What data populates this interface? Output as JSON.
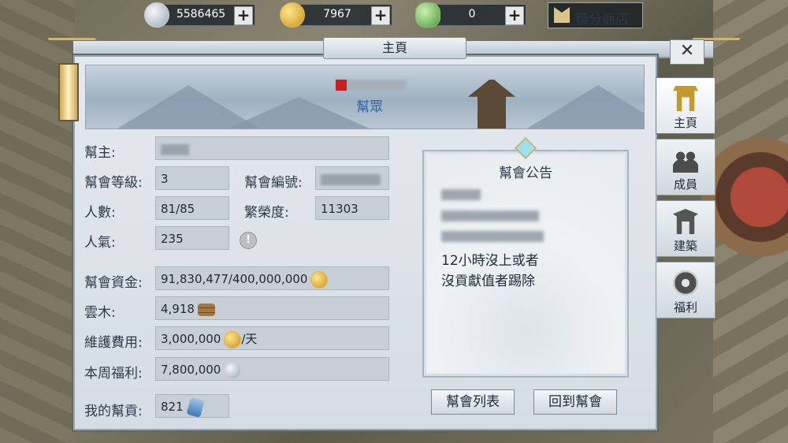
{
  "currencies": [
    {
      "name": "silver",
      "value": "5586465",
      "plus": "+"
    },
    {
      "name": "gold",
      "value": "7967",
      "plus": "+"
    },
    {
      "name": "jade",
      "value": "0",
      "plus": "+"
    }
  ],
  "shop_label": "積分商店",
  "window": {
    "title": "主頁",
    "close": "✕"
  },
  "banner": {
    "guild_type": "幫眾"
  },
  "info": {
    "leader_label": "幫主:",
    "level_label": "幫會等級:",
    "level": "3",
    "guild_id_label": "幫會編號:",
    "members_label": "人數:",
    "members": "81/85",
    "prosperity_label": "繁榮度:",
    "prosperity": "11303",
    "popularity_label": "人氣:",
    "popularity": "235",
    "funds_label": "幫會資金:",
    "funds": "91,830,477/400,000,000",
    "wood_label": "雲木:",
    "wood": "4,918",
    "maintenance_label": "維護費用:",
    "maintenance": "3,000,000",
    "maintenance_unit": "/天",
    "weekly_label": "本周福利:",
    "weekly": "7,800,000",
    "contrib_label": "我的幫貢:",
    "contrib": "821"
  },
  "notice": {
    "title": "幫會公告",
    "line4": "12小時沒上或者",
    "line5": "沒貢獻值者踢除"
  },
  "buttons": {
    "guild_list": "幫會列表",
    "return_guild": "回到幫會"
  },
  "tabs": [
    {
      "label": "主頁",
      "icon": "home-icon",
      "active": true
    },
    {
      "label": "成員",
      "icon": "members-icon"
    },
    {
      "label": "建築",
      "icon": "building-icon"
    },
    {
      "label": "福利",
      "icon": "welfare-icon"
    }
  ]
}
